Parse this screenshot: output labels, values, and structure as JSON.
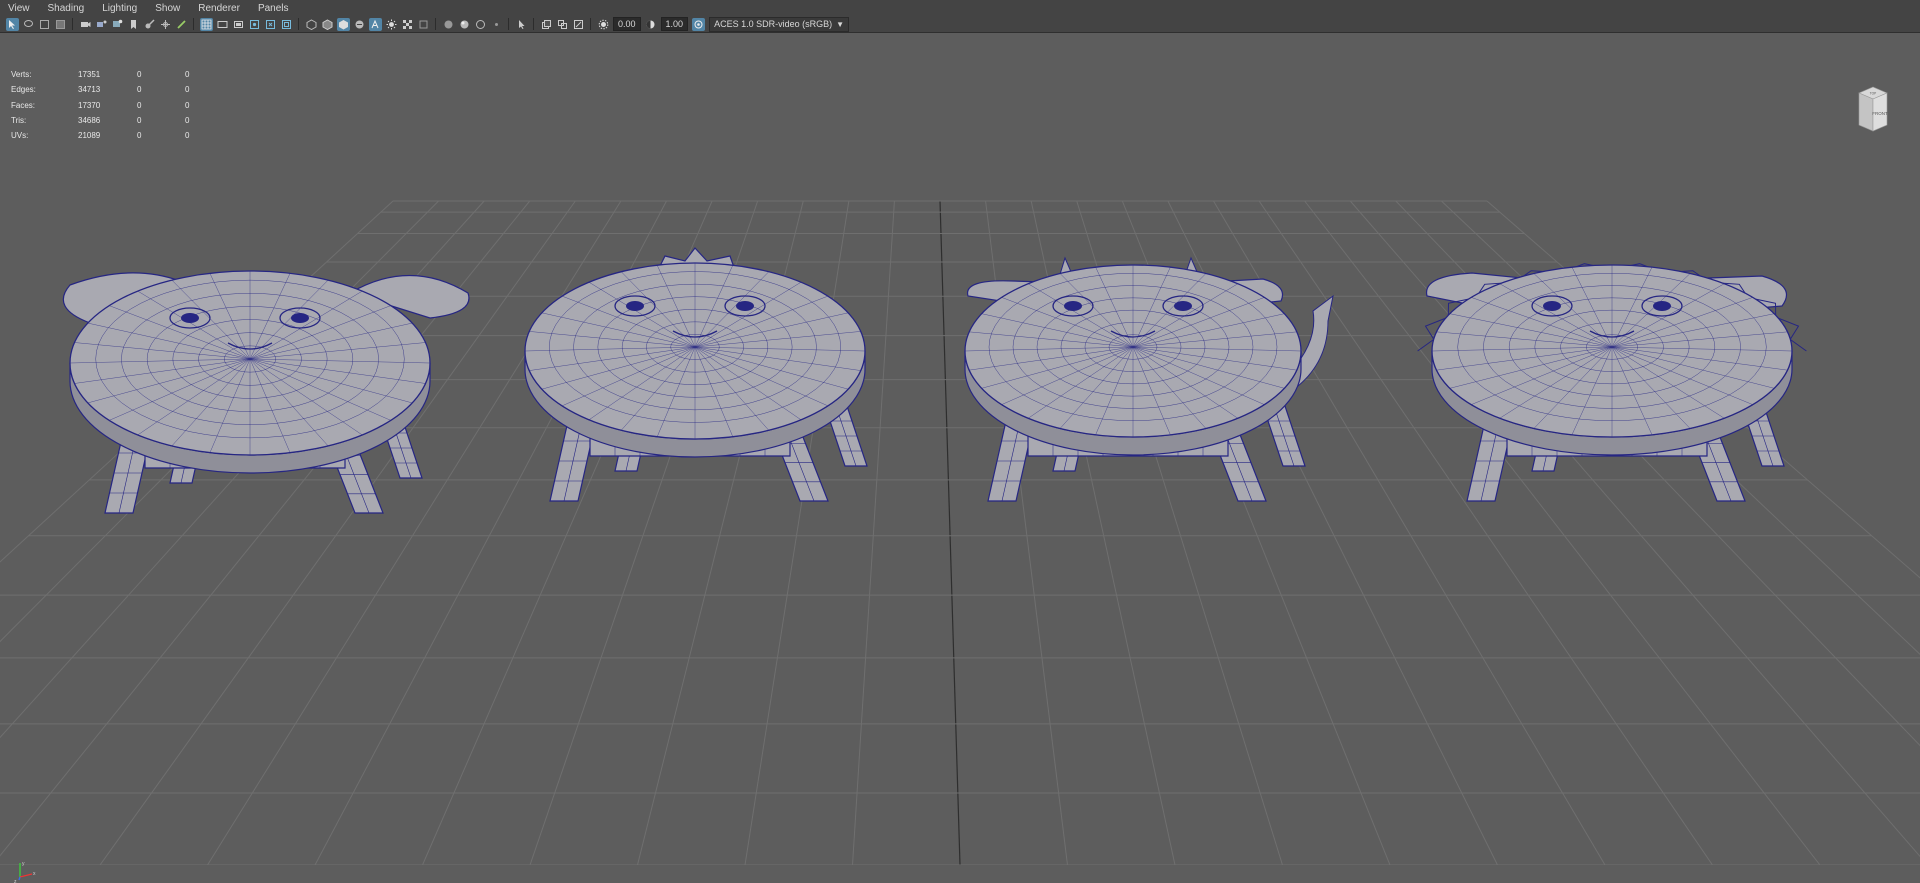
{
  "menu": {
    "items": [
      "View",
      "Shading",
      "Lighting",
      "Show",
      "Renderer",
      "Panels"
    ]
  },
  "toolbar": {
    "exposure_value": "0.00",
    "gamma_value": "1.00",
    "color_space": "ACES 1.0 SDR-video (sRGB)"
  },
  "hud": {
    "rows": [
      {
        "label": "Verts:",
        "v1": "17351",
        "v2": "0",
        "v3": "0"
      },
      {
        "label": "Edges:",
        "v1": "34713",
        "v2": "0",
        "v3": "0"
      },
      {
        "label": "Faces:",
        "v1": "17370",
        "v2": "0",
        "v3": "0"
      },
      {
        "label": "Tris:",
        "v1": "34686",
        "v2": "0",
        "v3": "0"
      },
      {
        "label": "UVs:",
        "v1": "21089",
        "v2": "0",
        "v3": "0"
      }
    ]
  },
  "viewcube": {
    "top_label": "TOP",
    "front_label": "FRONT"
  },
  "axis_labels": {
    "x": "x",
    "y": "y",
    "z": "z"
  },
  "colors": {
    "viewport_bg": "#5d5d5d",
    "grid_line": "#6f6f6f",
    "grid_center": "#2e2e2e",
    "wire": "#262683",
    "mesh_fill": "#a9a9b1",
    "toolbar_bg": "#444444",
    "accent": "#5285a6"
  },
  "icons": [
    "select-icon",
    "lasso-icon",
    "paint-select-icon",
    "soft-select-icon",
    "camera-icon",
    "camera-attr-icon",
    "bookmark-icon",
    "image-plane-icon",
    "grid-icon",
    "film-gate-icon",
    "resolution-gate-icon",
    "safe-action-icon",
    "wireframe-icon",
    "smooth-shade-icon",
    "wireframe-on-shaded-icon",
    "textured-icon",
    "lights-icon",
    "shadows-icon",
    "xray-icon",
    "backface-icon",
    "ssao-icon",
    "motion-blur-icon",
    "aa-icon",
    "isolate-icon",
    "xray-joints-icon",
    "exposure-icon",
    "gamma-icon",
    "color-management-icon"
  ],
  "stools": [
    {
      "name": "dog stool"
    },
    {
      "name": "chick stool"
    },
    {
      "name": "cow stool"
    },
    {
      "name": "lion stool"
    }
  ]
}
